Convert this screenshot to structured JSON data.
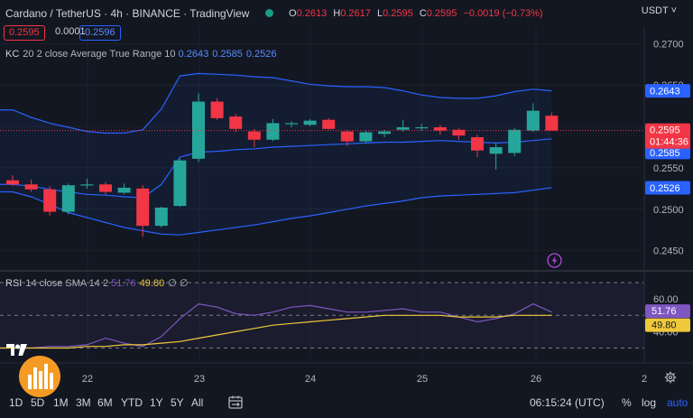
{
  "header": {
    "title": "Cardano / TetherUS · 4h · BINANCE · TradingView",
    "ohlc": [
      {
        "label": "O",
        "value": "0.2613"
      },
      {
        "label": "H",
        "value": "0.2617"
      },
      {
        "label": "L",
        "value": "0.2595"
      },
      {
        "label": "C",
        "value": "0.2595"
      }
    ],
    "change": "−0.0019 (−0.73%)",
    "currency": "USDT",
    "currency_caret": "˅",
    "sell_price": "0.2595",
    "spread": "0.0001",
    "buy_price": "0.2596"
  },
  "kc_legend": {
    "name": "KC",
    "params": "20 2 close Average True Range 10",
    "values": [
      "0.2643",
      "0.2585",
      "0.2526"
    ]
  },
  "rsi_legend": {
    "name": "RSI",
    "params": "14 close SMA 14 2",
    "rsi": "51.76",
    "sma": "49.80",
    "extra": "∅ ∅"
  },
  "price_axis": {
    "ticks": [
      "0.2700",
      "0.2650",
      "0.2600",
      "0.2550",
      "0.2500",
      "0.2450"
    ],
    "upper_label": "0.2643",
    "mid_label": "0.2585",
    "lower_label": "0.2526",
    "price_label": "0.2595",
    "countdown": "01:44:36"
  },
  "rsi_axis": {
    "ticks": [
      "60.00",
      "40.00"
    ],
    "rsi_label": "51.76",
    "sma_label": "49.80"
  },
  "time_axis": {
    "ticks": [
      "22",
      "23",
      "24",
      "25",
      "26",
      "2"
    ]
  },
  "bottom_bar": {
    "timeframes": [
      "1D",
      "5D",
      "1M",
      "3M",
      "6M",
      "YTD",
      "1Y",
      "5Y",
      "All"
    ],
    "time": "06:15:24 (UTC)",
    "percent": "%",
    "log": "log",
    "auto": "auto"
  },
  "colors": {
    "background": "#131722",
    "up": "#26a69a",
    "down": "#f23645",
    "band": "#2962ff",
    "rsi": "#7e57c2",
    "sma": "#f0c93a",
    "accent": "#2962ff"
  },
  "chart_data": [
    {
      "type": "candlestick",
      "title": "Cardano / TetherUS · 4h · BINANCE",
      "x_ticks": [
        "22",
        "23",
        "24",
        "25",
        "26"
      ],
      "y_range": [
        0.243,
        0.272
      ],
      "series": [
        {
          "name": "candles",
          "ohlc": [
            [
              0.2535,
              0.2541,
              0.2528,
              0.253
            ],
            [
              0.253,
              0.2536,
              0.2521,
              0.2524
            ],
            [
              0.2524,
              0.2528,
              0.2492,
              0.2497
            ],
            [
              0.2497,
              0.2531,
              0.2494,
              0.2529
            ],
            [
              0.2529,
              0.2537,
              0.2525,
              0.253
            ],
            [
              0.253,
              0.2533,
              0.2518,
              0.2521
            ],
            [
              0.252,
              0.2531,
              0.2518,
              0.2526
            ],
            [
              0.2525,
              0.2529,
              0.2467,
              0.248
            ],
            [
              0.248,
              0.2503,
              0.2478,
              0.2502
            ],
            [
              0.2504,
              0.2561,
              0.2503,
              0.2559
            ],
            [
              0.2561,
              0.264,
              0.2557,
              0.263
            ],
            [
              0.263,
              0.2634,
              0.2608,
              0.261
            ],
            [
              0.2612,
              0.2615,
              0.2593,
              0.2597
            ],
            [
              0.2594,
              0.2597,
              0.2575,
              0.2584
            ],
            [
              0.2584,
              0.2609,
              0.2582,
              0.2604
            ],
            [
              0.2603,
              0.2606,
              0.2599,
              0.2604
            ],
            [
              0.2602,
              0.2609,
              0.26,
              0.2607
            ],
            [
              0.2608,
              0.261,
              0.2596,
              0.2597
            ],
            [
              0.2594,
              0.2596,
              0.2576,
              0.2582
            ],
            [
              0.2582,
              0.2595,
              0.258,
              0.2593
            ],
            [
              0.2591,
              0.2596,
              0.2587,
              0.2594
            ],
            [
              0.2596,
              0.2608,
              0.2594,
              0.2599
            ],
            [
              0.2598,
              0.2603,
              0.2595,
              0.2599
            ],
            [
              0.2599,
              0.2602,
              0.259,
              0.2595
            ],
            [
              0.2596,
              0.2598,
              0.2584,
              0.2589
            ],
            [
              0.2587,
              0.259,
              0.2563,
              0.2571
            ],
            [
              0.2567,
              0.258,
              0.2548,
              0.2575
            ],
            [
              0.2568,
              0.2598,
              0.2564,
              0.2596
            ],
            [
              0.2595,
              0.2628,
              0.2593,
              0.2619
            ],
            [
              0.2613,
              0.2617,
              0.2595,
              0.2595
            ]
          ]
        },
        {
          "name": "KC upper",
          "values": [
            0.262,
            0.2611,
            0.2604,
            0.2599,
            0.2594,
            0.2592,
            0.2592,
            0.2596,
            0.2621,
            0.2661,
            0.2664,
            0.2663,
            0.2662,
            0.266,
            0.2659,
            0.2655,
            0.2651,
            0.2649,
            0.2648,
            0.2648,
            0.2647,
            0.2643,
            0.2638,
            0.2635,
            0.2634,
            0.2634,
            0.2637,
            0.2642,
            0.2645,
            0.2643
          ]
        },
        {
          "name": "KC middle",
          "values": [
            0.253,
            0.2528,
            0.2524,
            0.2521,
            0.2518,
            0.2517,
            0.2515,
            0.2514,
            0.253,
            0.2563,
            0.2569,
            0.257,
            0.2572,
            0.2573,
            0.2575,
            0.2576,
            0.2577,
            0.2578,
            0.2579,
            0.258,
            0.2581,
            0.2581,
            0.2582,
            0.2583,
            0.2582,
            0.2581,
            0.258,
            0.2581,
            0.2583,
            0.2585
          ]
        },
        {
          "name": "KC lower",
          "values": [
            0.2521,
            0.2515,
            0.2506,
            0.2496,
            0.249,
            0.2484,
            0.2478,
            0.2474,
            0.247,
            0.2469,
            0.2472,
            0.2475,
            0.2478,
            0.2481,
            0.2485,
            0.2489,
            0.2492,
            0.2496,
            0.25,
            0.2504,
            0.2507,
            0.251,
            0.2514,
            0.2516,
            0.2517,
            0.2518,
            0.2519,
            0.252,
            0.2523,
            0.2526
          ]
        }
      ]
    },
    {
      "type": "line",
      "title": "RSI 14 close SMA 14 2",
      "y_range": [
        22,
        75
      ],
      "reference_lines": [
        70,
        50,
        30
      ],
      "series": [
        {
          "name": "RSI",
          "values": [
            30,
            30,
            31,
            31,
            32,
            36,
            33,
            31,
            37,
            48,
            57,
            55,
            51,
            50,
            52,
            55,
            56,
            54,
            52,
            52,
            53,
            54,
            52,
            52,
            49,
            46,
            48,
            51,
            57,
            52
          ]
        },
        {
          "name": "SMA",
          "values": [
            30,
            30,
            30,
            30,
            31,
            31,
            32,
            32,
            33,
            34,
            36,
            38,
            40,
            42,
            44,
            45,
            46,
            47,
            48,
            49,
            50,
            50,
            50,
            50,
            49,
            49,
            49,
            50,
            50,
            50
          ]
        }
      ]
    }
  ]
}
